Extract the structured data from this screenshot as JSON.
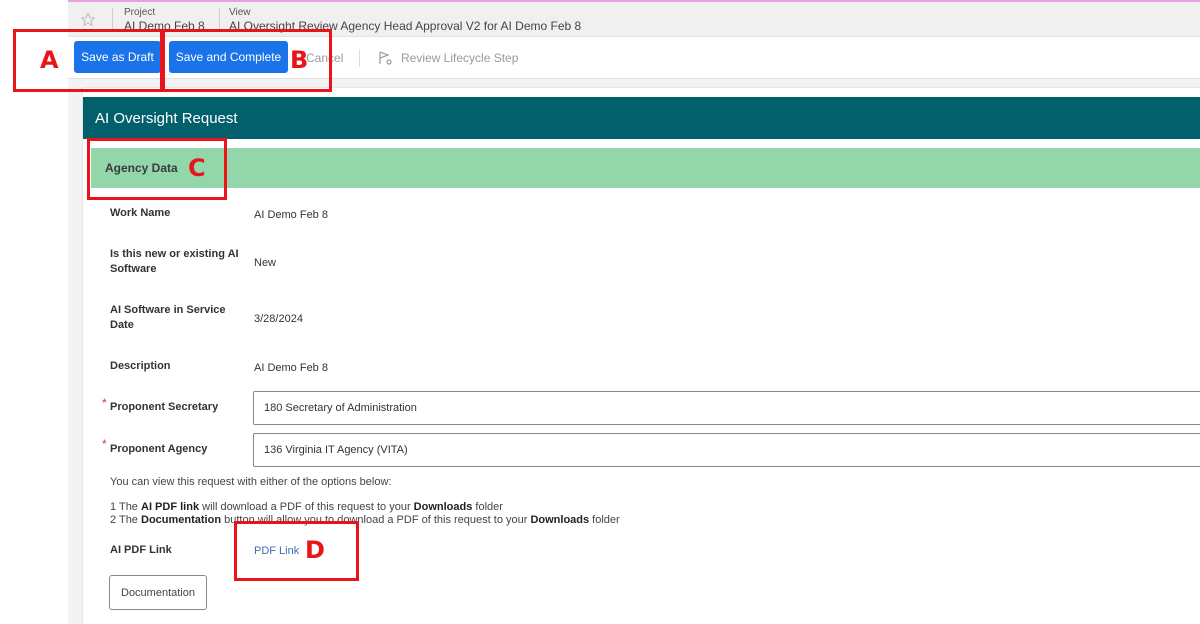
{
  "header": {
    "project_label": "Project",
    "project_value": "AI Demo Feb 8",
    "view_label": "View",
    "view_value": "AI Oversight Review Agency Head Approval V2 for AI Demo Feb 8"
  },
  "toolbar": {
    "save_draft": "Save as Draft",
    "save_complete": "Save and Complete",
    "cancel": "Cancel",
    "review_lifecycle": "Review Lifecycle Step"
  },
  "panel": {
    "title": "AI Oversight Request",
    "section_title": "Agency Data"
  },
  "fields": {
    "work_name_label": "Work Name",
    "work_name_value": "AI Demo Feb 8",
    "new_existing_label": "Is this new or existing AI Software",
    "new_existing_value": "New",
    "in_service_label": "AI Software in Service Date",
    "in_service_value": "3/28/2024",
    "description_label": "Description",
    "description_value": "AI Demo Feb 8",
    "secretary_label": "Proponent Secretary",
    "secretary_value": "180 Secretary of Administration",
    "agency_label": "Proponent Agency",
    "agency_value": "136 Virginia IT Agency (VITA)",
    "required_mark": "*"
  },
  "notes": {
    "intro": "You can view this request with either of the options below:",
    "line1_prefix": "1 The ",
    "line1_bold": "AI PDF link",
    "line1_mid": " will download a PDF of this request to your ",
    "line1_bold2": "Downloads",
    "line1_suffix": " folder",
    "line2_prefix": "2 The ",
    "line2_bold": "Documentation",
    "line2_mid": " button will allow you to download a PDF of this request to your ",
    "line2_bold2": "Downloads",
    "line2_suffix": " folder"
  },
  "pdf": {
    "label": "AI PDF Link",
    "link_text": "PDF Link"
  },
  "documentation_button": "Documentation",
  "callouts": {
    "a": "A",
    "b": "B",
    "c": "C",
    "d": "D"
  },
  "colors": {
    "primary_button": "#1a73e8",
    "panel_header": "#02606d",
    "section_bar": "#92d6aa",
    "callout": "#e8141a"
  },
  "icons": [
    "star-icon",
    "review-lifecycle-icon"
  ]
}
